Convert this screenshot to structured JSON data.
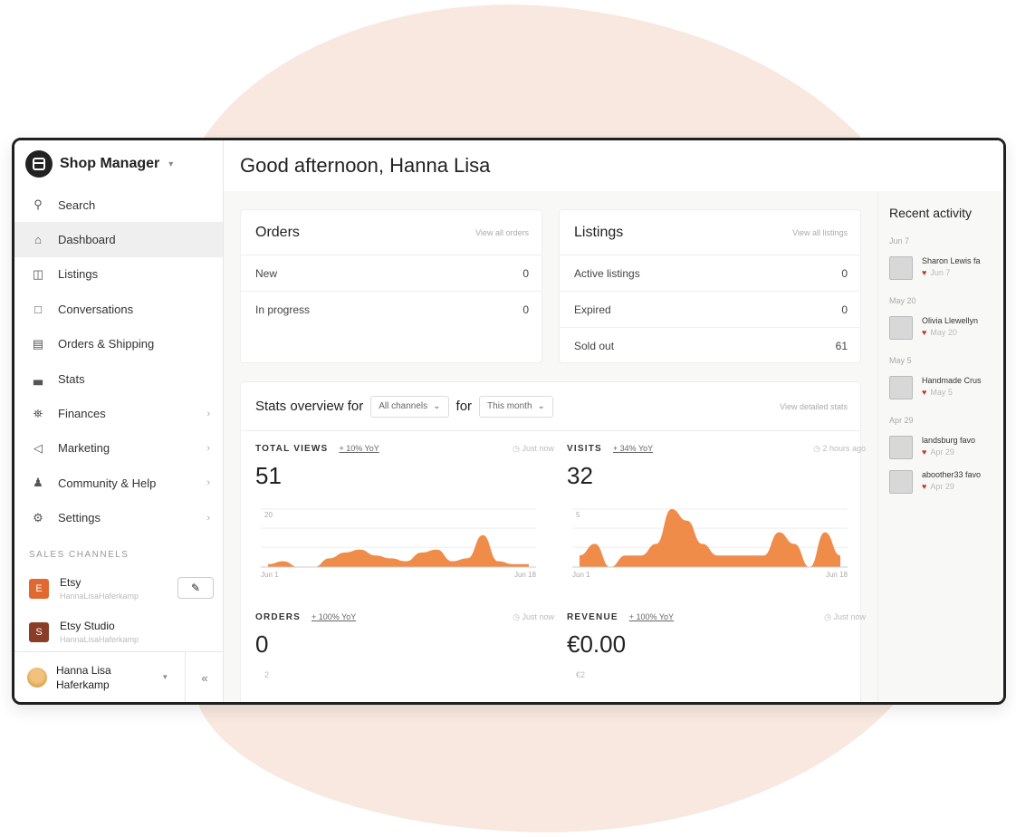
{
  "app": {
    "title": "Shop Manager"
  },
  "nav": [
    {
      "label": "Search",
      "icon": "search-icon"
    },
    {
      "label": "Dashboard",
      "icon": "home-icon"
    },
    {
      "label": "Listings",
      "icon": "listings-icon"
    },
    {
      "label": "Conversations",
      "icon": "chat-icon"
    },
    {
      "label": "Orders & Shipping",
      "icon": "clipboard-icon"
    },
    {
      "label": "Stats",
      "icon": "bar-chart-icon"
    },
    {
      "label": "Finances",
      "icon": "bank-icon"
    },
    {
      "label": "Marketing",
      "icon": "megaphone-icon"
    },
    {
      "label": "Community & Help",
      "icon": "people-icon"
    },
    {
      "label": "Settings",
      "icon": "gear-icon"
    }
  ],
  "channels": {
    "title": "SALES CHANNELS",
    "items": [
      {
        "name": "Etsy",
        "sub": "HannaLisaHaferkamp",
        "color": "#e0692f",
        "badge": "E"
      },
      {
        "name": "Etsy Studio",
        "sub": "HannaLisaHaferkamp",
        "color": "#8a3d27",
        "badge": "S"
      }
    ]
  },
  "user": {
    "name_line1": "Hanna Lisa",
    "name_line2": "Haferkamp",
    "collapse": "«"
  },
  "header": {
    "greeting": "Good afternoon, Hanna Lisa"
  },
  "orders": {
    "title": "Orders",
    "link": "View all orders",
    "rows": [
      {
        "label": "New",
        "value": "0"
      },
      {
        "label": "In progress",
        "value": "0"
      }
    ]
  },
  "listings": {
    "title": "Listings",
    "link": "View all listings",
    "rows": [
      {
        "label": "Active listings",
        "value": "0"
      },
      {
        "label": "Expired",
        "value": "0"
      },
      {
        "label": "Sold out",
        "value": "61"
      }
    ]
  },
  "stats": {
    "title": "Stats overview for",
    "channel": "All channels",
    "for_label": "for",
    "period": "This month",
    "link": "View detailed stats",
    "metrics": [
      {
        "label": "TOTAL VIEWS",
        "yoy": "+ 10% YoY",
        "time": "Just now",
        "value": "51",
        "ymax": "20",
        "x_start": "Jun 1",
        "x_end": "Jun 18"
      },
      {
        "label": "VISITS",
        "yoy": "+ 34% YoY",
        "time": "2 hours ago",
        "value": "32",
        "ymax": "5",
        "x_start": "Jun 1",
        "x_end": "Jun 18"
      },
      {
        "label": "ORDERS",
        "yoy": "+ 100% YoY",
        "time": "Just now",
        "value": "0",
        "ymax": "2"
      },
      {
        "label": "REVENUE",
        "yoy": "+ 100% YoY",
        "time": "Just now",
        "value": "€0.00",
        "ymax": "€2"
      }
    ]
  },
  "recent": {
    "title": "Recent activity",
    "groups": [
      {
        "date": "Jun 7",
        "name": "Sharon Lewis fa",
        "sub": "Jun 7"
      },
      {
        "date": "May 20",
        "name": "Olivia Llewellyn",
        "sub": "May 20"
      },
      {
        "date": "May 5",
        "name": "Handmade Crus",
        "sub": "May 5"
      },
      {
        "date": "Apr 29",
        "name": "landsburg favo",
        "sub": "Apr 29"
      },
      {
        "date": "",
        "name": "aboother33 favo",
        "sub": "Apr 29"
      }
    ]
  },
  "chart_data": [
    {
      "type": "area",
      "title": "TOTAL VIEWS",
      "x": [
        "Jun 1",
        "Jun 2",
        "Jun 3",
        "Jun 4",
        "Jun 5",
        "Jun 6",
        "Jun 7",
        "Jun 8",
        "Jun 9",
        "Jun 10",
        "Jun 11",
        "Jun 12",
        "Jun 13",
        "Jun 14",
        "Jun 15",
        "Jun 16",
        "Jun 17",
        "Jun 18"
      ],
      "values": [
        1,
        2,
        0,
        0,
        3,
        5,
        6,
        4,
        3,
        2,
        5,
        6,
        2,
        3,
        11,
        2,
        1,
        1
      ],
      "ylim": [
        0,
        20
      ],
      "color": "#f08c4a"
    },
    {
      "type": "area",
      "title": "VISITS",
      "x": [
        "Jun 1",
        "Jun 2",
        "Jun 3",
        "Jun 4",
        "Jun 5",
        "Jun 6",
        "Jun 7",
        "Jun 8",
        "Jun 9",
        "Jun 10",
        "Jun 11",
        "Jun 12",
        "Jun 13",
        "Jun 14",
        "Jun 15",
        "Jun 16",
        "Jun 17",
        "Jun 18"
      ],
      "values": [
        1,
        2,
        0,
        1,
        1,
        2,
        5,
        4,
        2,
        1,
        1,
        1,
        1,
        3,
        2,
        0,
        3,
        1
      ],
      "ylim": [
        0,
        5
      ],
      "color": "#f08c4a"
    }
  ]
}
